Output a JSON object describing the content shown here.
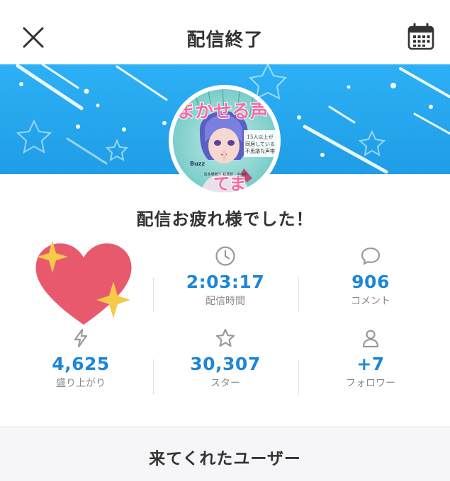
{
  "header": {
    "title": "配信終了",
    "close_icon": "close-icon",
    "calendar_icon": "calendar-icon"
  },
  "banner": {
    "background_color": "#29a8f0"
  },
  "avatar": {
    "title_top": "まかせる声",
    "title_bottom": "てま",
    "caption_lines": [
      "15人以上が",
      "同居している",
      "不思議な声帯"
    ],
    "tag": "Buzz",
    "badge": "吉多場最少 初見新 （ROM）"
  },
  "main": {
    "thanks_message": "配信お疲れ様でした！"
  },
  "stats": [
    {
      "icon": "clock-icon",
      "value": "2:03:17",
      "label": "配信時間"
    },
    {
      "icon": "comment-icon",
      "value": "906",
      "label": "コメント"
    },
    {
      "icon": "lightning-icon",
      "value": "4,625",
      "label": "盛り上がり"
    },
    {
      "icon": "star-icon",
      "value": "30,307",
      "label": "スター"
    },
    {
      "icon": "person-icon",
      "value": "+7",
      "label": "フォロワー"
    }
  ],
  "colors": {
    "accent": "#1c86d9",
    "heart": "#e9596e",
    "sparkle": "#f7c948"
  },
  "footer": {
    "button_label": "来てくれたユーザー"
  }
}
